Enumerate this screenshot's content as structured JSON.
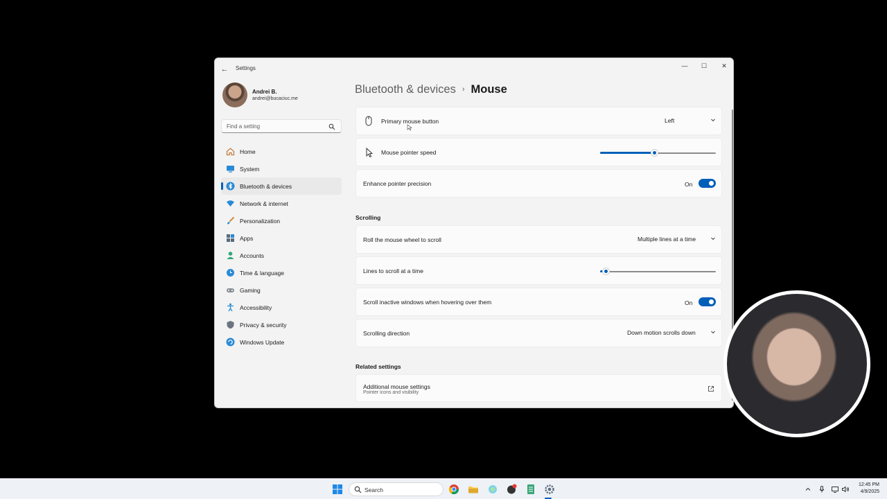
{
  "window": {
    "title": "Settings",
    "controls": {
      "minimize": "—",
      "maximize": "☐",
      "close": "✕"
    },
    "back": "←"
  },
  "profile": {
    "name": "Andrei B.",
    "email": "andrei@bucaciuc.me"
  },
  "search": {
    "placeholder": "Find a setting"
  },
  "nav": {
    "items": [
      {
        "label": "Home",
        "icon": "home-icon"
      },
      {
        "label": "System",
        "icon": "system-icon"
      },
      {
        "label": "Bluetooth & devices",
        "icon": "bluetooth-icon",
        "active": true
      },
      {
        "label": "Network & internet",
        "icon": "wifi-icon"
      },
      {
        "label": "Personalization",
        "icon": "brush-icon"
      },
      {
        "label": "Apps",
        "icon": "apps-icon"
      },
      {
        "label": "Accounts",
        "icon": "accounts-icon"
      },
      {
        "label": "Time & language",
        "icon": "globe-clock-icon"
      },
      {
        "label": "Gaming",
        "icon": "gamepad-icon"
      },
      {
        "label": "Accessibility",
        "icon": "accessibility-icon"
      },
      {
        "label": "Privacy & security",
        "icon": "shield-icon"
      },
      {
        "label": "Windows Update",
        "icon": "update-icon"
      }
    ]
  },
  "breadcrumb": {
    "parent": "Bluetooth & devices",
    "separator": "›",
    "current": "Mouse"
  },
  "settings": {
    "primary_button": {
      "label": "Primary mouse button",
      "value": "Left"
    },
    "pointer_speed": {
      "label": "Mouse pointer speed",
      "level": 0.47
    },
    "enhance_precision": {
      "label": "Enhance pointer precision",
      "state": "On"
    }
  },
  "scrolling": {
    "heading": "Scrolling",
    "roll_wheel": {
      "label": "Roll the mouse wheel to scroll",
      "value": "Multiple lines at a time"
    },
    "lines": {
      "label": "Lines to scroll at a time",
      "level": 0.05
    },
    "inactive_windows": {
      "label": "Scroll inactive windows when hovering over them",
      "state": "On"
    },
    "direction": {
      "label": "Scrolling direction",
      "value": "Down motion scrolls down"
    }
  },
  "related": {
    "heading": "Related settings",
    "additional": {
      "label": "Additional mouse settings",
      "sub": "Pointer icons and visibility"
    }
  },
  "taskbar": {
    "search_label": "Search",
    "time": "12:45 PM",
    "date": "4/9/2025"
  },
  "colors": {
    "accent": "#005fb8",
    "window_bg": "#f3f3f3",
    "card_bg": "#fbfbfb"
  }
}
